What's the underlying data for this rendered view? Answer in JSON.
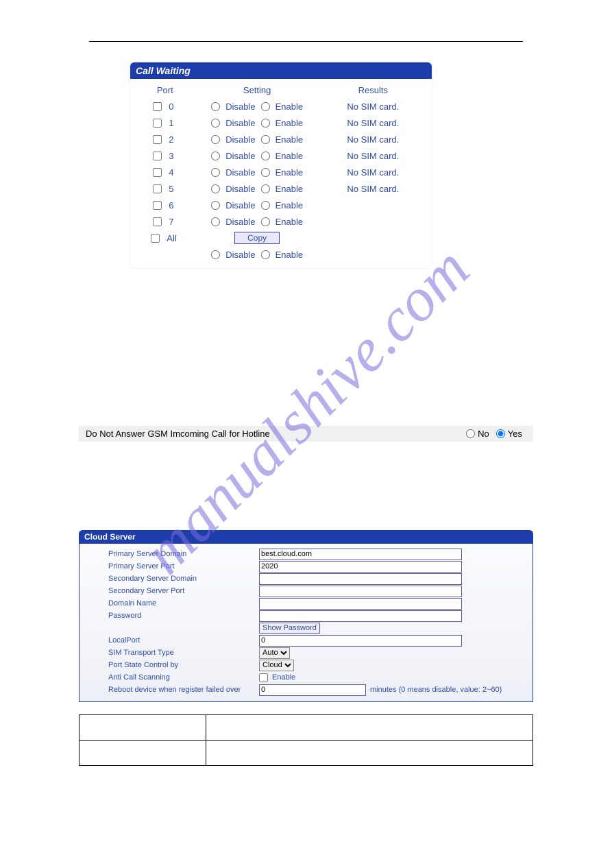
{
  "watermark": "manualshive.com",
  "callWaiting": {
    "title": "Call Waiting",
    "headers": {
      "port": "Port",
      "setting": "Setting",
      "results": "Results"
    },
    "disableLabel": "Disable",
    "enableLabel": "Enable",
    "allLabel": "All",
    "copyLabel": "Copy",
    "rows": [
      {
        "port": "0",
        "result": "No SIM card."
      },
      {
        "port": "1",
        "result": "No SIM card."
      },
      {
        "port": "2",
        "result": "No SIM card."
      },
      {
        "port": "3",
        "result": "No SIM card."
      },
      {
        "port": "4",
        "result": "No SIM card."
      },
      {
        "port": "5",
        "result": "No SIM card."
      },
      {
        "port": "6",
        "result": ""
      },
      {
        "port": "7",
        "result": ""
      }
    ]
  },
  "dnr": {
    "label": "Do Not Answer GSM Imcoming Call for Hotline",
    "noLabel": "No",
    "yesLabel": "Yes",
    "selected": "yes"
  },
  "cloudServer": {
    "title": "Cloud Server",
    "fields": {
      "primaryDomain": {
        "label": "Primary Server Domain",
        "value": "best.cloud.com"
      },
      "primaryPort": {
        "label": "Primary Server Port",
        "value": "2020"
      },
      "secondaryDomain": {
        "label": "Secondary Server Domain",
        "value": ""
      },
      "secondaryPort": {
        "label": "Secondary Server Port",
        "value": ""
      },
      "domainName": {
        "label": "Domain Name",
        "value": ""
      },
      "password": {
        "label": "Password",
        "showBtn": "Show Password"
      },
      "localPort": {
        "label": "LocalPort",
        "value": "0"
      },
      "simTransport": {
        "label": "SIM Transport Type",
        "value": "Auto"
      },
      "portStateControl": {
        "label": "Port State Control by",
        "value": "Cloud"
      },
      "antiCallScanning": {
        "label": "Anti Call Scanning",
        "enableLabel": "Enable"
      },
      "reboot": {
        "label": "Reboot device when register failed over",
        "value": "0",
        "note": "minutes (0 means disable, value: 2~60)"
      }
    }
  }
}
